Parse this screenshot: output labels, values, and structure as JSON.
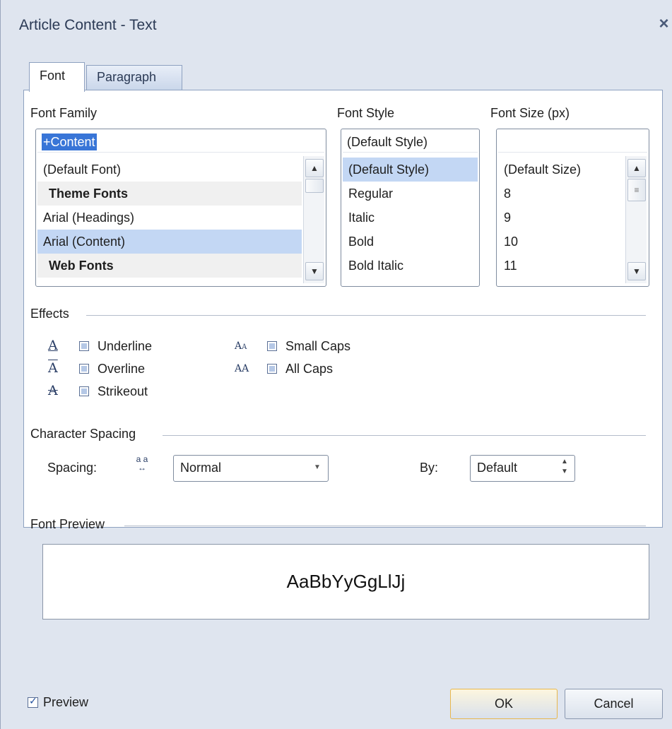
{
  "window": {
    "title": "Article Content - Text",
    "close": "×"
  },
  "tabs": [
    {
      "label": "Font",
      "active": true
    },
    {
      "label": "Paragraph",
      "active": false
    }
  ],
  "font_family": {
    "label": "Font Family",
    "value": "+Content",
    "items": [
      {
        "label": "(Default Font)",
        "type": "item"
      },
      {
        "label": "Theme Fonts",
        "type": "group"
      },
      {
        "label": "Arial (Headings)",
        "type": "item"
      },
      {
        "label": "Arial (Content)",
        "type": "selected"
      },
      {
        "label": "Web Fonts",
        "type": "group"
      }
    ]
  },
  "font_style": {
    "label": "Font Style",
    "value": "(Default Style)",
    "items": [
      "(Default Style)",
      "Regular",
      "Italic",
      "Bold",
      "Bold Italic"
    ]
  },
  "font_size": {
    "label": "Font Size (px)",
    "value": "",
    "items": [
      "(Default Size)",
      "8",
      "9",
      "10",
      "11"
    ]
  },
  "effects": {
    "label": "Effects",
    "underline": "Underline",
    "overline": "Overline",
    "strikeout": "Strikeout",
    "small_caps": "Small Caps",
    "all_caps": "All Caps",
    "icon_underline": "A",
    "icon_overline": "A",
    "icon_strikeout": "A",
    "icon_small_caps": "Aa",
    "icon_all_caps": "AA"
  },
  "spacing": {
    "label": "Character Spacing",
    "spacing_label": "Spacing:",
    "spacing_value": "Normal",
    "by_label": "By:",
    "by_value": "Default"
  },
  "preview": {
    "label": "Font Preview",
    "sample": "AaBbYyGgLlJj",
    "checkbox_label": "Preview",
    "checked": true
  },
  "buttons": {
    "ok": "OK",
    "cancel": "Cancel"
  },
  "colors": {
    "selection": "#c3d7f4",
    "accent": "#2a3e66",
    "ok_border": "#e8b74c"
  }
}
